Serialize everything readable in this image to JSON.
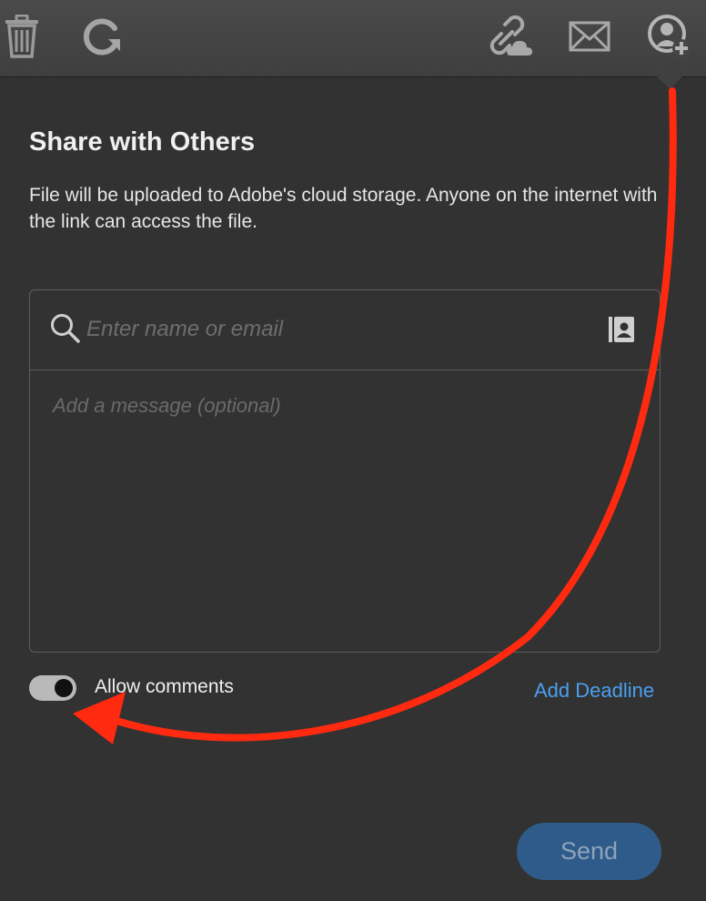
{
  "toolbar": {
    "icons": [
      "trash-icon",
      "refresh-icon",
      "link-cloud-icon",
      "envelope-icon",
      "add-person-icon"
    ]
  },
  "share": {
    "title": "Share with Others",
    "description": "File will be uploaded to Adobe's cloud storage. Anyone on the internet with the link can access the file.",
    "recipient_placeholder": "Enter name or email",
    "recipient_value": "",
    "message_placeholder": "Add a message (optional)",
    "message_value": "",
    "allow_comments_label": "Allow comments",
    "allow_comments_enabled": true,
    "add_deadline_label": "Add Deadline",
    "send_label": "Send"
  },
  "colors": {
    "background": "#323232",
    "toolbar": "#464646",
    "link": "#4a9ff0",
    "send_button": "#2f5b8a",
    "annotation_arrow": "#ff2a0f"
  }
}
